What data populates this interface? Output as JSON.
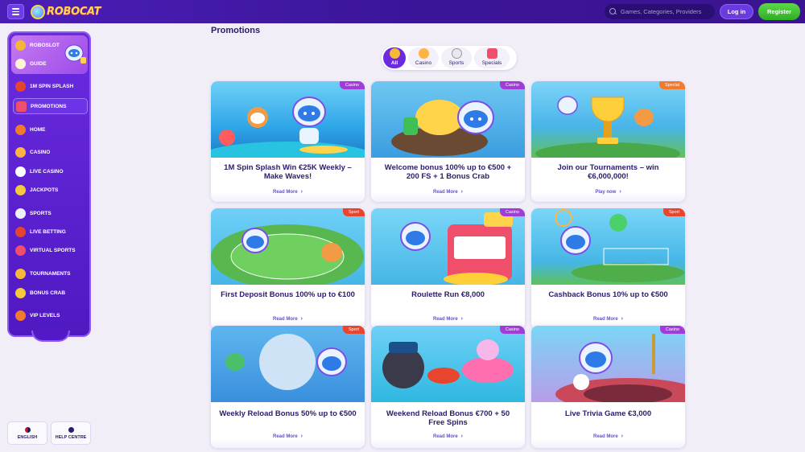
{
  "header": {
    "logo_text": "ROBOCAT",
    "search_placeholder": "Games, Categories, Providers",
    "login_label": "Log in",
    "register_label": "Register"
  },
  "sidebar": {
    "items": [
      {
        "label": "ROBOSLOT",
        "icon": "coin-icon"
      },
      {
        "label": "GUIDE",
        "icon": "guide-icon"
      },
      {
        "label": "1M SPIN SPLASH",
        "icon": "splash-icon"
      },
      {
        "label": "PROMOTIONS",
        "icon": "gift-icon"
      },
      {
        "label": "HOME",
        "icon": "home-icon"
      },
      {
        "label": "CASINO",
        "icon": "casino-icon"
      },
      {
        "label": "LIVE CASINO",
        "icon": "live-casino-icon"
      },
      {
        "label": "JACKPOTS",
        "icon": "jackpot-icon"
      },
      {
        "label": "SPORTS",
        "icon": "ball-icon"
      },
      {
        "label": "LIVE BETTING",
        "icon": "live-betting-icon"
      },
      {
        "label": "VIRTUAL SPORTS",
        "icon": "virtual-sports-icon"
      },
      {
        "label": "TOURNAMENTS",
        "icon": "trophy-icon"
      },
      {
        "label": "BONUS CRAB",
        "icon": "crab-icon"
      },
      {
        "label": "VIP LEVELS",
        "icon": "vip-icon"
      }
    ],
    "language_label": "ENGLISH",
    "help_label": "HELP CENTRE"
  },
  "main": {
    "title": "Promotions",
    "filters": [
      {
        "label": "All",
        "active": true
      },
      {
        "label": "Casino",
        "active": false
      },
      {
        "label": "Sports",
        "active": false
      },
      {
        "label": "Specials",
        "active": false
      }
    ],
    "cards": [
      {
        "tag": "Casino",
        "title": "1M Spin Splash Win €25K Weekly – Make Waves!",
        "link": "Read More"
      },
      {
        "tag": "Casino",
        "title": "Welcome bonus 100% up to €500 + 200 FS + 1 Bonus Crab",
        "link": "Read More"
      },
      {
        "tag": "Special",
        "title": "Join our Tournaments – win €6,000,000!",
        "link": "Play now"
      },
      {
        "tag": "Sport",
        "title": "First Deposit Bonus 100% up to €100",
        "link": "Read More"
      },
      {
        "tag": "Casino",
        "title": "Roulette Run €8,000",
        "link": "Read More"
      },
      {
        "tag": "Sport",
        "title": "Cashback Bonus 10% up to €500",
        "link": "Read More"
      },
      {
        "tag": "Sport",
        "title": "Weekly Reload Bonus 50% up to €500",
        "link": "Read More"
      },
      {
        "tag": "Casino",
        "title": "Weekend Reload Bonus €700 + 50 Free Spins",
        "link": "Read More"
      },
      {
        "tag": "Casino",
        "title": "Live Trivia Game €3,000",
        "link": "Read More"
      }
    ]
  },
  "colors": {
    "casino_tag": "#a23cd9",
    "sport_tag": "#e8452f",
    "special_tag": "#f27a2c",
    "accent": "#6a2be0"
  }
}
